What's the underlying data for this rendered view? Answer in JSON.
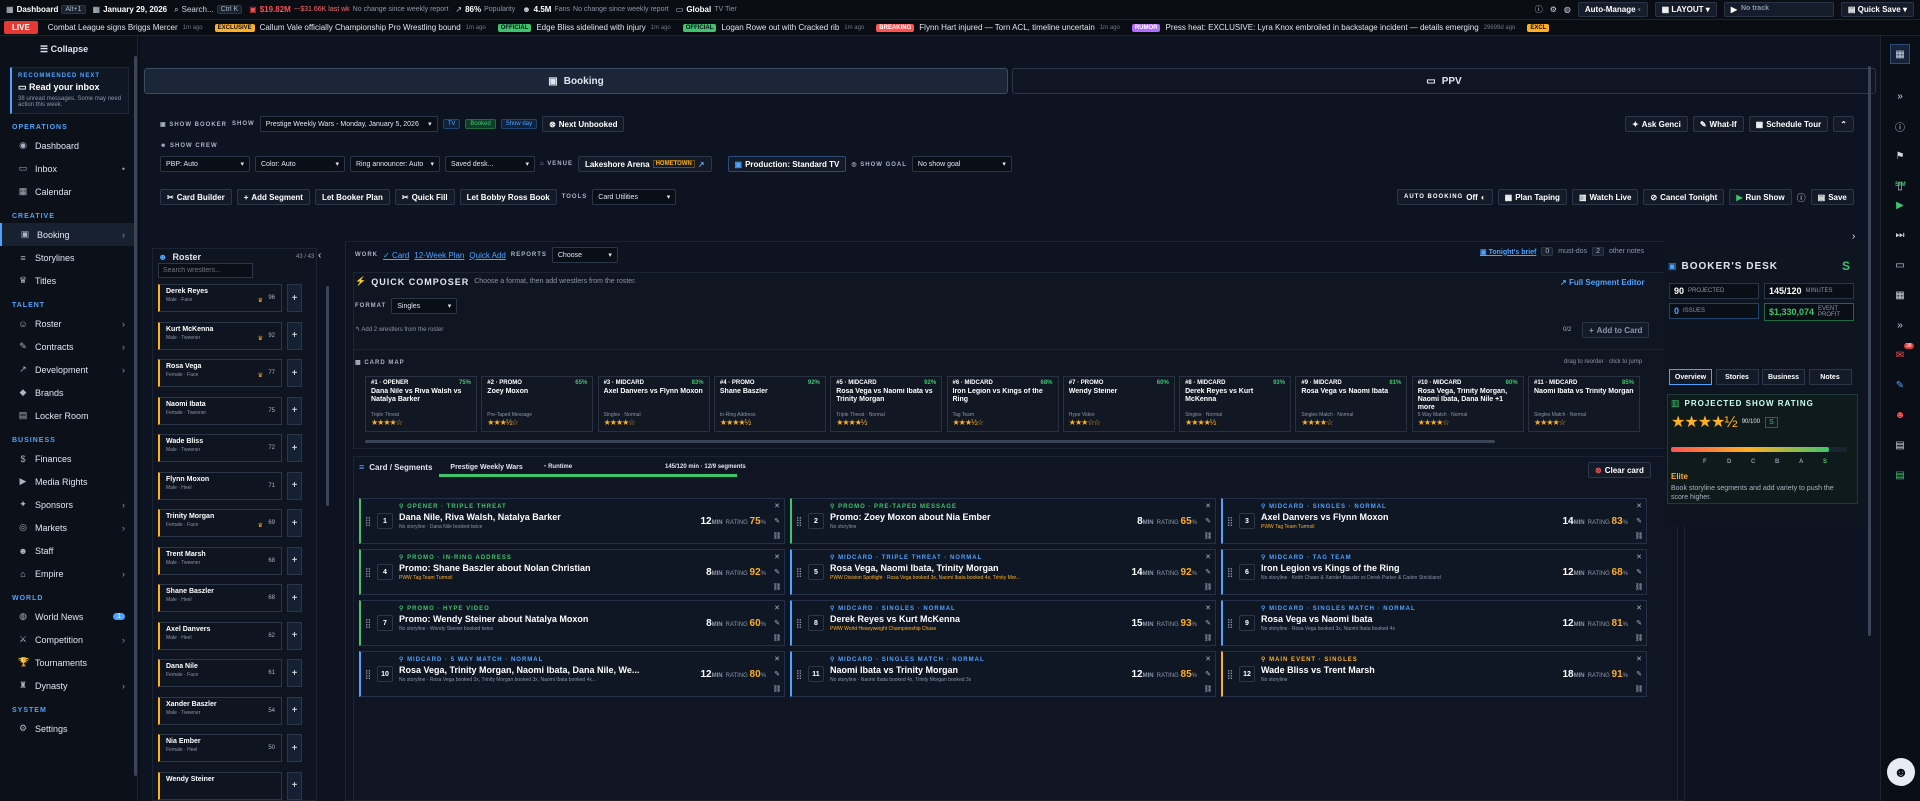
{
  "topbar": {
    "title": "Dashboard",
    "title_kbd": "Alt+1",
    "date": "January 29, 2026",
    "search": "Search...",
    "search_kbd": "Ctrl K",
    "money": "$19.82M",
    "money_change": "~-$31.66K last wk",
    "money_note": "No change since weekly report",
    "popularity": "86%",
    "popularity_label": "Popularity",
    "fans": "4.5M",
    "fans_label": "Fans",
    "fans_note": "No change since weekly report",
    "tier": "Global",
    "tier_label": "TV Tier",
    "auto": "Auto-Manage",
    "layout": "LAYOUT",
    "track": "No track",
    "quicksave": "Quick Save"
  },
  "ticker": {
    "live": "LIVE",
    "items": [
      {
        "tag": "",
        "text": "Combat League signs Briggs Mercer",
        "ago": "1m ago"
      },
      {
        "tag": "EXCLUSIVE",
        "cls": "ex",
        "text": "Callum Vale officially Championship Pro Wrestling bound",
        "ago": "1m ago"
      },
      {
        "tag": "OFFICIAL",
        "cls": "of",
        "text": "Edge Bliss sidelined with injury",
        "ago": "1m ago"
      },
      {
        "tag": "OFFICIAL",
        "cls": "of",
        "text": "Logan Rowe out with Cracked rib",
        "ago": "1m ago"
      },
      {
        "tag": "BREAKING",
        "cls": "br",
        "text": "Flynn Hart injured — Torn ACL, timeline uncertain",
        "ago": "1m ago"
      },
      {
        "tag": "RUMOR",
        "cls": "ru",
        "text": "Press heat: EXCLUSIVE: Lyra Knox embroiled in backstage incident — details emerging",
        "ago": "29699d ago"
      },
      {
        "tag": "EXCL",
        "cls": "ex",
        "text": "",
        "ago": ""
      }
    ]
  },
  "sidebar": {
    "collapse": "Collapse",
    "rec_kicker": "RECOMMENDED NEXT",
    "rec_title": "Read your inbox",
    "rec_desc": "38 unread messages. Some may need action this week.",
    "sections": [
      {
        "title": "OPERATIONS",
        "items": [
          {
            "label": "Dashboard",
            "icon": "◉"
          },
          {
            "label": "Inbox",
            "icon": "▭",
            "dot": "•"
          },
          {
            "label": "Calendar",
            "icon": "▦"
          }
        ]
      },
      {
        "title": "CREATIVE",
        "items": [
          {
            "label": "Booking",
            "icon": "▣",
            "active": true,
            "chev": "›"
          },
          {
            "label": "Storylines",
            "icon": "≡"
          },
          {
            "label": "Titles",
            "icon": "♛"
          }
        ]
      },
      {
        "title": "TALENT",
        "items": [
          {
            "label": "Roster",
            "icon": "☺",
            "chev": "›"
          },
          {
            "label": "Contracts",
            "icon": "✎",
            "chev": "›"
          },
          {
            "label": "Development",
            "icon": "↗",
            "chev": "›"
          },
          {
            "label": "Brands",
            "icon": "◆"
          },
          {
            "label": "Locker Room",
            "icon": "▤"
          }
        ]
      },
      {
        "title": "BUSINESS",
        "items": [
          {
            "label": "Finances",
            "icon": "$"
          },
          {
            "label": "Media Rights",
            "icon": "▶"
          },
          {
            "label": "Sponsors",
            "icon": "✦",
            "chev": "›"
          },
          {
            "label": "Markets",
            "icon": "◎",
            "chev": "›"
          },
          {
            "label": "Staff",
            "icon": "☻"
          },
          {
            "label": "Empire",
            "icon": "⌂",
            "chev": "›"
          }
        ]
      },
      {
        "title": "WORLD",
        "items": [
          {
            "label": "World News",
            "icon": "◍",
            "badge": "1"
          },
          {
            "label": "Competition",
            "icon": "⚔",
            "chev": "›"
          },
          {
            "label": "Tournaments",
            "icon": "🏆"
          },
          {
            "label": "Dynasty",
            "icon": "♜",
            "chev": "›"
          }
        ]
      },
      {
        "title": "SYSTEM",
        "items": [
          {
            "label": "Settings",
            "icon": "⚙"
          }
        ]
      }
    ]
  },
  "tabs": {
    "booking": "Booking",
    "ppv": "PPV"
  },
  "booker": {
    "label": "SHOW BOOKER",
    "show_label": "SHOW",
    "show_value": "Prestige Weekly Wars - Monday, January 5, 2026",
    "chip_tv": "TV",
    "chip_booked": "Booked",
    "chip_day": "Show day",
    "next_unbooked": "Next Unbooked",
    "ask": "Ask Genci",
    "whatif": "What-If",
    "schedule": "Schedule Tour",
    "crew_label": "SHOW CREW",
    "pbp": "PBP: Auto",
    "color": "Color: Auto",
    "ring": "Ring announcer: Auto",
    "saved": "Saved desk...",
    "venue_label": "VENUE",
    "venue": "Lakeshore Arena",
    "hometown": "HOMETOWN",
    "production": "Production: Standard TV",
    "goal_label": "SHOW GOAL",
    "goal": "No show goal",
    "card_builder": "Card Builder",
    "add_segment": "Add Segment",
    "let_booker": "Let Booker Plan",
    "quick_fill": "Quick Fill",
    "let_bobby": "Let Bobby Ross Book",
    "tools_label": "TOOLS",
    "tools": "Card Utilities",
    "auto_booking": "AUTO BOOKING",
    "auto_state": "Off",
    "plan_taping": "Plan Taping",
    "watch_live": "Watch Live",
    "cancel": "Cancel Tonight",
    "run": "Run Show",
    "save": "Save"
  },
  "roster": {
    "title": "Roster",
    "count": "43 / 43",
    "search": "Search wrestlers...",
    "items": [
      {
        "name": "Derek Reyes",
        "sub": "Male · Face",
        "rating": "96",
        "crown": true
      },
      {
        "name": "Kurt McKenna",
        "sub": "Male · Tweener",
        "rating": "92",
        "crown": true
      },
      {
        "name": "Rosa Vega",
        "sub": "Female · Face",
        "rating": "77",
        "crown": true
      },
      {
        "name": "Naomi Ibata",
        "sub": "Female · Tweener",
        "rating": "75"
      },
      {
        "name": "Wade Bliss",
        "sub": "Male · Tweener",
        "rating": "72"
      },
      {
        "name": "Flynn Moxon",
        "sub": "Male · Heel",
        "rating": "71"
      },
      {
        "name": "Trinity Morgan",
        "sub": "Female · Face",
        "rating": "69",
        "crown": true
      },
      {
        "name": "Trent Marsh",
        "sub": "Male · Tweener",
        "rating": "68"
      },
      {
        "name": "Shane Baszler",
        "sub": "Male · Heel",
        "rating": "68"
      },
      {
        "name": "Axel Danvers",
        "sub": "Male · Heel",
        "rating": "62"
      },
      {
        "name": "Dana Nile",
        "sub": "Female · Face",
        "rating": "61"
      },
      {
        "name": "Xander Baszler",
        "sub": "Male · Tweener",
        "rating": "54"
      },
      {
        "name": "Nia Ember",
        "sub": "Female · Heel",
        "rating": "50"
      },
      {
        "name": "Wendy Steiner",
        "sub": "",
        "rating": ""
      }
    ]
  },
  "work": {
    "label": "WORK",
    "card": "Card",
    "plan": "12-Week Plan",
    "quick": "Quick Add",
    "reports_label": "REPORTS",
    "reports": "Choose",
    "brief": "Tonight's brief",
    "mustdos": "0",
    "mustdos_label": "must-dos",
    "notes": "2",
    "notes_label": "other notes"
  },
  "composer": {
    "title": "QUICK COMPOSER",
    "hint": "Choose a format, then add wrestlers from the roster.",
    "full": "Full Segment Editor",
    "format_label": "FORMAT",
    "format": "Singles",
    "need": "Add 2 wrestlers from the roster",
    "count": "0/2",
    "add": "Add to Card"
  },
  "cardmap": {
    "label": "CARD MAP",
    "hint": "drag to reorder · click to jump",
    "items": [
      {
        "head": "#1 · OPENER",
        "pct": "75%",
        "title": "Dana Nile vs Riva Walsh vs Natalya Barker",
        "sub": "Triple Threat",
        "stars": "★★★★☆"
      },
      {
        "head": "#2 · PROMO",
        "pct": "65%",
        "title": "Zoey Moxon",
        "sub": "Pre-Taped Message",
        "stars": "★★★½☆"
      },
      {
        "head": "#3 · MIDCARD",
        "pct": "83%",
        "title": "Axel Danvers vs Flynn Moxon",
        "sub": "Singles · Normal",
        "stars": "★★★★☆"
      },
      {
        "head": "#4 · PROMO",
        "pct": "92%",
        "title": "Shane Baszler",
        "sub": "In-Ring Address",
        "stars": "★★★★½"
      },
      {
        "head": "#5 · MIDCARD",
        "pct": "92%",
        "title": "Rosa Vega vs Naomi Ibata vs Trinity Morgan",
        "sub": "Triple Threat · Normal",
        "stars": "★★★★½"
      },
      {
        "head": "#6 · MIDCARD",
        "pct": "68%",
        "title": "Iron Legion vs Kings of the Ring",
        "sub": "Tag Team",
        "stars": "★★★½☆"
      },
      {
        "head": "#7 · PROMO",
        "pct": "60%",
        "title": "Wendy Steiner",
        "sub": "Hype Video",
        "stars": "★★★☆☆"
      },
      {
        "head": "#8 · MIDCARD",
        "pct": "93%",
        "title": "Derek Reyes vs Kurt McKenna",
        "sub": "Singles · Normal",
        "stars": "★★★★½"
      },
      {
        "head": "#9 · MIDCARD",
        "pct": "81%",
        "title": "Rosa Vega vs Naomi Ibata",
        "sub": "Singles Match · Normal",
        "stars": "★★★★☆"
      },
      {
        "head": "#10 · MIDCARD",
        "pct": "80%",
        "title": "Rosa Vega, Trinity Morgan, Naomi Ibata, Dana Nile +1 more",
        "sub": "5 Way Match · Normal",
        "stars": "★★★★☆"
      },
      {
        "head": "#11 · MIDCARD",
        "pct": "85%",
        "title": "Naomi Ibata vs Trinity Morgan",
        "sub": "Singles Match · Normal",
        "stars": "★★★★☆"
      }
    ]
  },
  "segments": {
    "title": "Card / Segments",
    "show": "Prestige Weekly Wars",
    "runtime_label": "Runtime",
    "runtime": "145/120 min · 12/9 segments",
    "clear": "Clear card",
    "items": [
      {
        "n": "1",
        "kind": "OPENER · TRIPLE THREAT",
        "title": "Dana Nile, Riva Walsh, Natalya Barker",
        "sub": "No storyline · Dana Nile booked twice",
        "yel": false,
        "mins": "12",
        "rating": "75",
        "color": "#3ec46d"
      },
      {
        "n": "2",
        "kind": "PROMO · PRE-TAPED MESSAGE",
        "title": "Promo: Zoey Moxon about Nia Ember",
        "sub": "No storyline",
        "yel": false,
        "mins": "8",
        "rating": "65",
        "color": "#3ec46d"
      },
      {
        "n": "3",
        "kind": "MIDCARD · SINGLES · NORMAL",
        "title": "Axel Danvers vs Flynn Moxon",
        "sub": "PWW Tag Team Turmoil",
        "yel": true,
        "mins": "14",
        "rating": "83",
        "color": "#4da3ff"
      },
      {
        "n": "4",
        "kind": "PROMO · IN-RING ADDRESS",
        "title": "Promo: Shane Baszler about Nolan Christian",
        "sub": "PWW Tag Team Turmoil",
        "yel": true,
        "mins": "8",
        "rating": "92",
        "color": "#3ec46d"
      },
      {
        "n": "5",
        "kind": "MIDCARD · TRIPLE THREAT · NORMAL",
        "title": "Rosa Vega, Naomi Ibata, Trinity Morgan",
        "sub": "PWW Division Spotlight · Rosa Vega booked 3x, Naomi Ibata booked 4x, Trinity Mor...",
        "yel": true,
        "mins": "14",
        "rating": "92",
        "color": "#4da3ff"
      },
      {
        "n": "6",
        "kind": "MIDCARD · TAG TEAM",
        "title": "Iron Legion vs Kings of the Ring",
        "sub": "No storyline · Keith Chase & Xander Baszler vs Derek Parker & Caden Strickland",
        "yel": false,
        "mins": "12",
        "rating": "68",
        "color": "#4da3ff"
      },
      {
        "n": "7",
        "kind": "PROMO · HYPE VIDEO",
        "title": "Promo: Wendy Steiner about Natalya Moxon",
        "sub": "No storyline · Wendy Steiner booked twice",
        "yel": false,
        "mins": "8",
        "rating": "60",
        "color": "#3ec46d"
      },
      {
        "n": "8",
        "kind": "MIDCARD · SINGLES · NORMAL",
        "title": "Derek Reyes vs Kurt McKenna",
        "sub": "PWW World Heavyweight Championship Chase",
        "yel": true,
        "mins": "15",
        "rating": "93",
        "color": "#4da3ff"
      },
      {
        "n": "9",
        "kind": "MIDCARD · SINGLES MATCH · NORMAL",
        "title": "Rosa Vega vs Naomi Ibata",
        "sub": "No storyline · Rosa Vega booked 3x, Naomi Ibata booked 4x",
        "yel": false,
        "mins": "12",
        "rating": "81",
        "color": "#4da3ff"
      },
      {
        "n": "10",
        "kind": "MIDCARD · 5 WAY MATCH · NORMAL",
        "title": "Rosa Vega, Trinity Morgan, Naomi Ibata, Dana Nile, We...",
        "sub": "No storyline · Rosa Vega booked 3x, Trinity Morgan booked 3x, Naomi Ibata booked 4x...",
        "yel": false,
        "mins": "12",
        "rating": "80",
        "color": "#4da3ff"
      },
      {
        "n": "11",
        "kind": "MIDCARD · SINGLES MATCH · NORMAL",
        "title": "Naomi Ibata vs Trinity Morgan",
        "sub": "No storyline · Naomi Ibata booked 4x, Trinity Morgan booked 3x",
        "yel": false,
        "mins": "12",
        "rating": "85",
        "color": "#4da3ff"
      },
      {
        "n": "12",
        "kind": "MAIN EVENT · SINGLES",
        "title": "Wade Bliss vs Trent Marsh",
        "sub": "No storyline",
        "yel": false,
        "mins": "18",
        "rating": "91",
        "color": "#ffb020"
      }
    ],
    "min": "MIN",
    "rating_label": "RATING"
  },
  "desk": {
    "title": "BOOKER'S DESK",
    "grade": "S",
    "projected": "90",
    "projected_label": "PROJECTED",
    "minutes": "145/120",
    "minutes_label": "MINUTES",
    "issues": "0",
    "issues_label": "ISSUES",
    "profit": "$1,330,074",
    "profit_label": "EVENT PROFIT",
    "tabs": [
      "Overview",
      "Stories",
      "Business",
      "Notes"
    ],
    "rating_title": "PROJECTED SHOW RATING",
    "stars": "★★★★½",
    "score": "90/100",
    "score_grade": "S",
    "grades": [
      "F",
      "D",
      "C",
      "B",
      "A",
      "S"
    ],
    "rating_fraction": 0.9,
    "tier": "Elite",
    "advice": "Book storyline segments and add variety to push the score higher."
  },
  "rail": {
    "sim": "SIM",
    "alert": "38"
  }
}
